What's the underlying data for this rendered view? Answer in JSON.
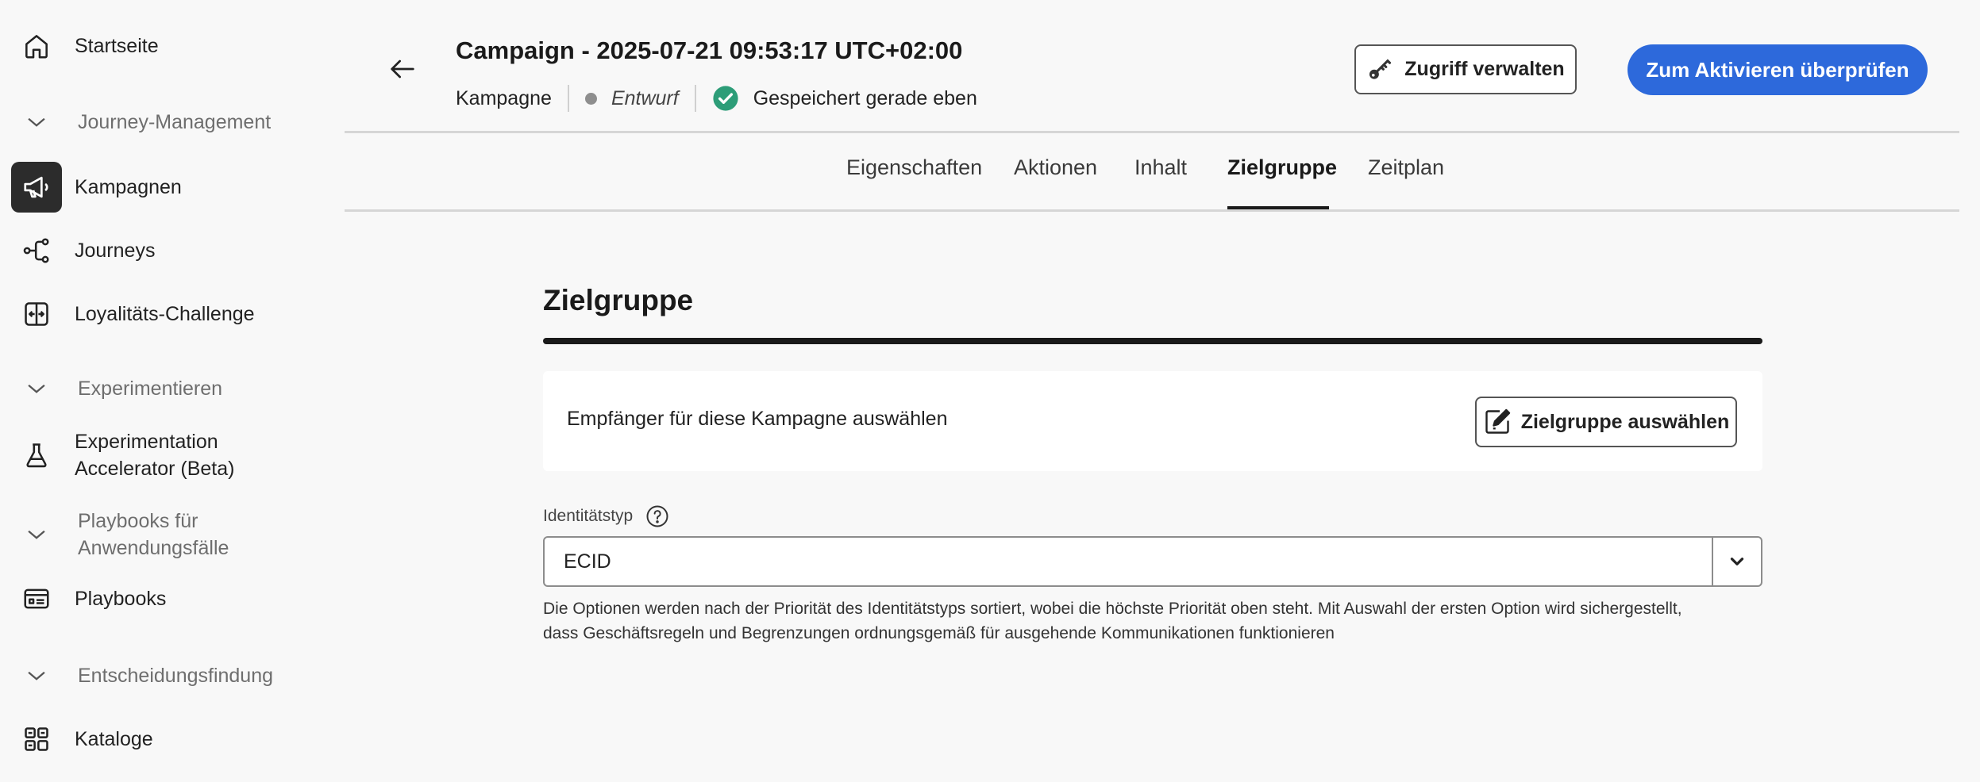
{
  "sidebar": {
    "items": [
      {
        "label": "Startseite",
        "icon": "home-icon"
      },
      {
        "section": "Journey-Management"
      },
      {
        "label": "Kampagnen",
        "icon": "megaphone-icon",
        "active": true
      },
      {
        "label": "Journeys",
        "icon": "journey-icon"
      },
      {
        "label": "Loyalitäts-Challenge",
        "icon": "challenge-icon"
      },
      {
        "section": "Experimentieren"
      },
      {
        "label_line1": "Experimentation",
        "label_line2": "Accelerator (Beta)",
        "icon": "flask-icon"
      },
      {
        "section_line1": "Playbooks für",
        "section_line2": "Anwendungsfälle"
      },
      {
        "label": "Playbooks",
        "icon": "playbook-icon"
      },
      {
        "section": "Entscheidungsfindung"
      },
      {
        "label": "Kataloge",
        "icon": "catalog-icon"
      }
    ]
  },
  "header": {
    "title": "Campaign - 2025-07-21 09:53:17 UTC+02:00",
    "type": "Kampagne",
    "status": "Entwurf",
    "saved": "Gespeichert gerade eben",
    "manage_access": "Zugriff verwalten",
    "review_activate": "Zum Aktivieren überprüfen"
  },
  "tabs": [
    {
      "label": "Eigenschaften"
    },
    {
      "label": "Aktionen"
    },
    {
      "label": "Inhalt"
    },
    {
      "label": "Zielgruppe",
      "active": true
    },
    {
      "label": "Zeitplan"
    }
  ],
  "main": {
    "heading": "Zielgruppe",
    "card_text": "Empfänger für diese Kampagne auswählen",
    "select_audience": "Zielgruppe auswählen",
    "identity_label": "Identitätstyp",
    "identity_value": "ECID",
    "help_line1": "Die Optionen werden nach der Priorität des Identitätstyps sortiert, wobei die höchste Priorität oben steht. Mit Auswahl der ersten Option wird sichergestellt,",
    "help_line2": "dass Geschäftsregeln und Begrenzungen ordnungsgemäß für ausgehende Kommunikationen funktionieren"
  },
  "colors": {
    "primary": "#2d69db",
    "success": "#2d9d78",
    "active_nav": "#2c2c2c"
  }
}
